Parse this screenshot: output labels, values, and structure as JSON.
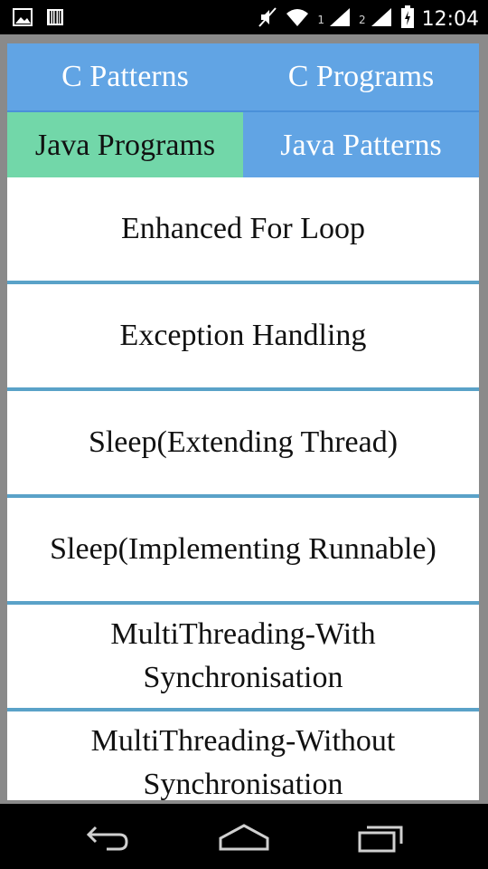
{
  "status_bar": {
    "icons": [
      "image-icon",
      "barcode-icon",
      "mute-icon",
      "wifi-icon",
      "signal-icon",
      "signal-icon",
      "battery-icon"
    ],
    "sim1_label": "1",
    "sim2_label": "2",
    "time": "12:04"
  },
  "tabs": {
    "row1": [
      {
        "label": "C Patterns"
      },
      {
        "label": "C Programs"
      }
    ],
    "row2": [
      {
        "label": "Java Programs",
        "selected": true
      },
      {
        "label": "Java Patterns"
      }
    ]
  },
  "list": {
    "items": [
      {
        "label": "Enhanced For Loop"
      },
      {
        "label": "Exception Handling"
      },
      {
        "label": "Sleep(Extending Thread)"
      },
      {
        "label": "Sleep(Implementing Runnable)"
      },
      {
        "label": "MultiThreading-With\nSynchronisation"
      },
      {
        "label": "MultiThreading-Without\nSynchronisation"
      }
    ]
  },
  "nav_bar": {
    "icons": [
      "back-icon",
      "home-icon",
      "recents-icon"
    ]
  },
  "colors": {
    "tab_blue": "#61a4e4",
    "tab_selected": "#72d7a9",
    "divider": "#5aa2c8"
  }
}
